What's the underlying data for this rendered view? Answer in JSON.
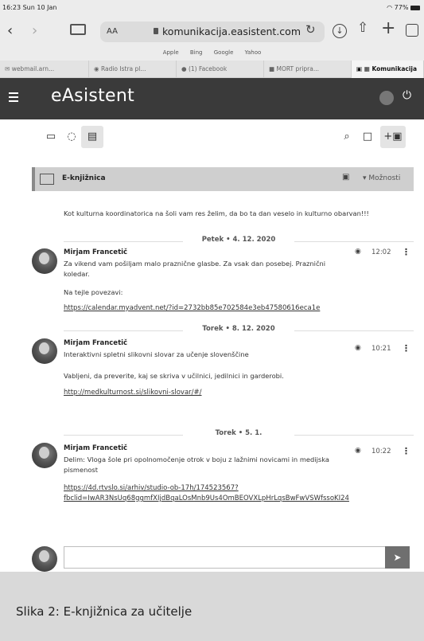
{
  "status_bar": {
    "time_date": "16:23  Sun 10 Jan",
    "battery": "77%"
  },
  "browser": {
    "reader_label": "AA",
    "url": "komunikacija.easistent.com",
    "bookmarks": [
      "Apple",
      "Bing",
      "Google",
      "Yahoo"
    ],
    "tabs": [
      "webmail.arn...",
      "Radio Istra pl...",
      "(1) Facebook",
      "MORT pripra...",
      "Komunikacija"
    ]
  },
  "app": {
    "title": "eAsistent"
  },
  "section": {
    "name": "E-knjižnica",
    "options": "Možnosti"
  },
  "intro": "Kot kulturna koordinatorica na šoli vam res želim, da bo ta dan veselo in kulturno obarvan!!!",
  "posts": [
    {
      "date": "Petek • 4. 12. 2020",
      "author": "Mirjam Francetič",
      "time": "12:02",
      "text1": "Za vikend vam pošiljam malo praznične glasbe. Za vsak dan posebej. Praznični koledar.",
      "text2": "Na tejle povezavi:",
      "link": "https://calendar.myadvent.net/?id=2732bb85e702584e3eb47580616eca1e"
    },
    {
      "date": "Torek • 8. 12. 2020",
      "author": "Mirjam Francetič",
      "time": "10:21",
      "text1": "Interaktivni spletni slikovni slovar za učenje slovenščine",
      "text2": "Vabljeni, da preverite, kaj se skriva v učilnici, jedilnici in garderobi.",
      "link": "http://medkulturnost.si/slikovni-slovar/#/"
    },
    {
      "date": "Torek • 5. 1.",
      "author": "Mirjam Francetič",
      "time": "10:22",
      "text1": "Delim: Vloga šole pri opolnomočenje otrok v boju z lažnimi novicami in medijska pismenost",
      "link1": "https://4d.rtvslo.si/arhiv/studio-ob-17h/174523567?",
      "link2": "fbclid=IwAR3NsUq68ggmfXIjdBqaLOsMnb9Us4OmBEOVXLpHrLqsBwFwVSWfssoKI24"
    }
  ],
  "caption": "Slika 2: E-knjižnica za učitelje"
}
